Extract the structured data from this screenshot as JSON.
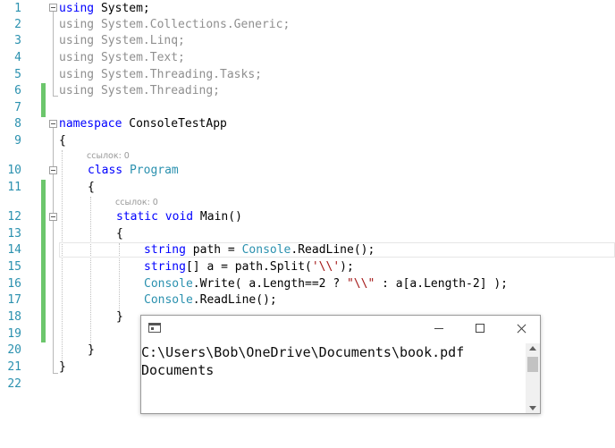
{
  "editor": {
    "line_numbers": [
      "1",
      "2",
      "3",
      "4",
      "5",
      "6",
      "7",
      "8",
      "9",
      "10",
      "11",
      "12",
      "13",
      "14",
      "15",
      "16",
      "17",
      "18",
      "19",
      "20",
      "21",
      "22"
    ],
    "lines": {
      "l1": {
        "kw": "using",
        "rest": " System;"
      },
      "l2": {
        "text": "using System.Collections.Generic;"
      },
      "l3": {
        "text": "using System.Linq;"
      },
      "l4": {
        "text": "using System.Text;"
      },
      "l5": {
        "text": "using System.Threading.Tasks;"
      },
      "l6": {
        "text": "using System.Threading;"
      },
      "l8": {
        "kw": "namespace",
        "rest": " ConsoleTestApp"
      },
      "l9": {
        "text": "{"
      },
      "l10": {
        "kw": "class",
        "type": "Program"
      },
      "l11": {
        "text": "{"
      },
      "l12": {
        "kw1": "static",
        "kw2": "void",
        "rest": " Main()"
      },
      "l13": {
        "text": "{"
      },
      "l14": {
        "kw": "string",
        "mid": " path = ",
        "type": "Console",
        "rest": ".ReadLine();"
      },
      "l15": {
        "kw": "string",
        "mid": "[] a = path.Split(",
        "str": "'\\\\'",
        "rest": ");"
      },
      "l16": {
        "type": "Console",
        "mid": ".Write( a.Length==2 ? ",
        "str": "\"\\\\\"",
        "rest": " : a[a.Length-2] );"
      },
      "l17": {
        "type": "Console",
        "rest": ".ReadLine();"
      },
      "l18": {
        "text": "}"
      },
      "l20": {
        "text": "}"
      },
      "l21": {
        "text": "}"
      }
    },
    "codelens": {
      "class_refs": "ссылок: 0",
      "main_refs": "ссылок: 0"
    }
  },
  "console": {
    "output_line1": "C:\\Users\\Bob\\OneDrive\\Documents\\book.pdf",
    "output_line2": "Documents"
  }
}
